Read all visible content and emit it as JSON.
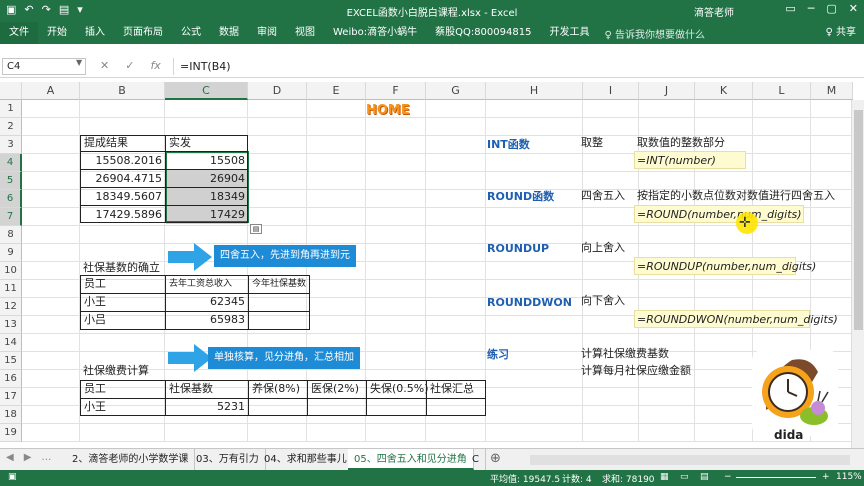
{
  "window": {
    "title": "EXCEL函数小白脱白课程.xlsx  -  Excel",
    "user": "滴答老师",
    "quick_access": [
      "save-icon",
      "undo-icon",
      "redo-icon",
      "open-icon",
      "customize-icon"
    ]
  },
  "ribbon": {
    "tabs": [
      "文件",
      "开始",
      "插入",
      "页面布局",
      "公式",
      "数据",
      "审阅",
      "视图",
      "Weibo:滴答小蜗牛",
      "蔡股QQ:800094815",
      "开发工具"
    ],
    "tell_me": "♀ 告诉我你想要做什么",
    "share": "♀ 共享"
  },
  "formula_bar": {
    "name_box": "C4",
    "formula": "=INT(B4)"
  },
  "columns": [
    "A",
    "B",
    "C",
    "D",
    "E",
    "F",
    "G",
    "H",
    "I",
    "J",
    "K",
    "L",
    "M"
  ],
  "rows": [
    "1",
    "2",
    "3",
    "4",
    "5",
    "6",
    "7",
    "8",
    "9",
    "10",
    "11",
    "12",
    "13",
    "14",
    "15",
    "16",
    "17",
    "18",
    "19"
  ],
  "sheet": {
    "home_label": "HOME",
    "table1": {
      "headers": [
        "提成结果",
        "实发"
      ],
      "rows": [
        [
          "15508.2016",
          "15508"
        ],
        [
          "26904.4715",
          "26904"
        ],
        [
          "18349.5607",
          "18349"
        ],
        [
          "17429.5896",
          "17429"
        ]
      ]
    },
    "callout1": "四舍五入，先进到角再进到元",
    "section2_title": "社保基数的确立",
    "table2": {
      "headers": [
        "员工",
        "去年工资总收入",
        "今年社保基数"
      ],
      "rows": [
        [
          "小王",
          "62345",
          ""
        ],
        [
          "小吕",
          "65983",
          ""
        ]
      ]
    },
    "callout2": "单独核算，见分进角，汇总相加",
    "section3_title": "社保缴费计算",
    "table3": {
      "headers": [
        "员工",
        "社保基数",
        "养保(8%)",
        "医保(2%)",
        "失保(0.5%)",
        "社保汇总"
      ],
      "rows": [
        [
          "小王",
          "5231",
          "",
          "",
          "",
          ""
        ]
      ]
    },
    "functions": [
      {
        "name": "INT函数",
        "kind": "取整",
        "desc": "取数值的整数部分",
        "syntax": "=INT(number)"
      },
      {
        "name": "ROUND函数",
        "kind": "四舍五入",
        "desc": "按指定的小数点位数对数值进行四舍五入",
        "syntax": "=ROUND(number,num_digits)"
      },
      {
        "name": "ROUNDUP",
        "kind": "向上舍入",
        "desc": "",
        "syntax": "=ROUNDUP(number,num_digits)"
      },
      {
        "name": "ROUNDDWON",
        "kind": "向下舍入",
        "desc": "",
        "syntax": "=ROUNDDWON(number,num_digits)"
      }
    ],
    "practice": {
      "label": "练习",
      "items": [
        "计算社保缴费基数",
        "计算每月社保应缴金额"
      ]
    },
    "logo_text": "dida"
  },
  "sheet_tabs": [
    "2、滴答老师的小学数学课",
    "03、万有引力",
    "04、求和那些事儿",
    "05、四舍五入和见分进角",
    "C"
  ],
  "active_sheet_index": 3,
  "status_bar": {
    "average": "平均值: 19547.5",
    "count": "计数: 4",
    "sum": "求和: 78190",
    "zoom": "115%"
  },
  "colors": {
    "excel_green": "#217346",
    "callout_blue": "#1e8bd6",
    "home_orange": "#f7941d",
    "func_blue": "#1f5fb0",
    "yellow_fill": "#fffbd1"
  }
}
